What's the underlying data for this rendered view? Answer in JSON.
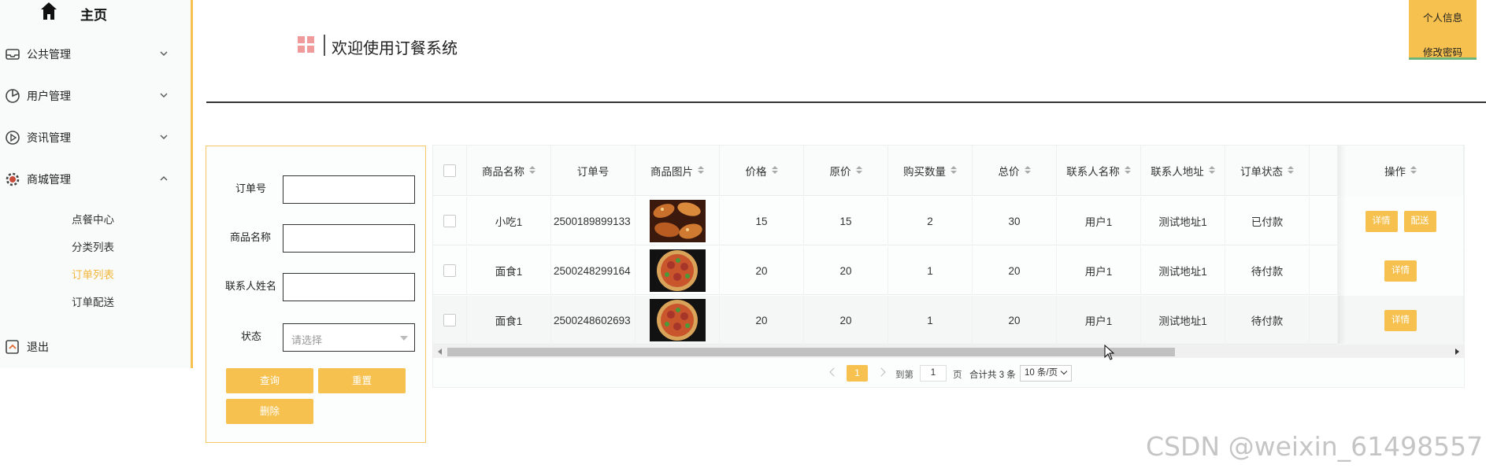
{
  "sidebar": {
    "home_label": "主页",
    "menus": [
      {
        "label": "公共管理",
        "expanded": false
      },
      {
        "label": "用户管理",
        "expanded": false
      },
      {
        "label": "资讯管理",
        "expanded": false
      },
      {
        "label": "商城管理",
        "expanded": true
      }
    ],
    "sub_items": [
      "点餐中心",
      "分类列表",
      "订单列表",
      "订单配送"
    ],
    "active_sub": "订单列表",
    "logout_label": "退出"
  },
  "header": {
    "title": "欢迎使用订餐系统",
    "user_menu": [
      "个人信息",
      "修改密码"
    ]
  },
  "search": {
    "order_no_label": "订单号",
    "product_name_label": "商品名称",
    "contact_name_label": "联系人姓名",
    "status_label": "状态",
    "status_placeholder": "请选择",
    "query_button": "查询",
    "reset_button": "重置",
    "delete_button": "删除"
  },
  "table": {
    "columns": [
      "商品名称",
      "订单号",
      "商品图片",
      "价格",
      "原价",
      "购买数量",
      "总价",
      "联系人名称",
      "联系人地址",
      "订单状态"
    ],
    "action_column": "操作",
    "rows": [
      {
        "name": "小吃1",
        "order_no": "2500189899133",
        "price": "15",
        "orig_price": "15",
        "qty": "2",
        "total": "30",
        "contact": "用户1",
        "address": "测试地址1",
        "status": "已付款",
        "actions": [
          "详情",
          "配送"
        ],
        "image": "chicken-wings"
      },
      {
        "name": "面食1",
        "order_no": "2500248299164",
        "price": "20",
        "orig_price": "20",
        "qty": "1",
        "total": "20",
        "contact": "用户1",
        "address": "测试地址1",
        "status": "待付款",
        "actions": [
          "详情"
        ],
        "image": "noodle-bowl"
      },
      {
        "name": "面食1",
        "order_no": "2500248602693",
        "price": "20",
        "orig_price": "20",
        "qty": "1",
        "total": "20",
        "contact": "用户1",
        "address": "测试地址1",
        "status": "待付款",
        "actions": [
          "详情"
        ],
        "image": "noodle-bowl"
      }
    ]
  },
  "pagination": {
    "current_page": "1",
    "goto_label": "到第",
    "goto_value": "1",
    "page_unit": "页",
    "total_text": "合计共 3 条",
    "page_size": "10 条/页"
  },
  "watermark": "CSDN @weixin_61498557",
  "colors": {
    "accent": "#f6c14e",
    "active_text": "#f3b63b"
  }
}
